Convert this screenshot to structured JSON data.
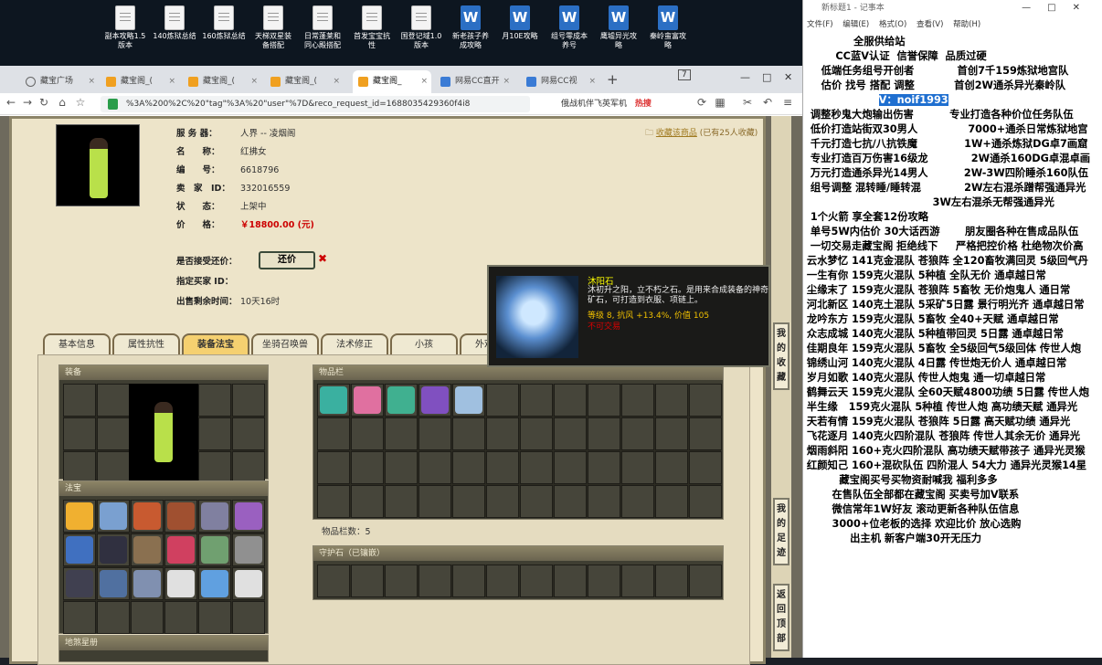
{
  "desktop": {
    "icons": [
      {
        "label": "副本攻略1.5\n版本",
        "kind": "txt"
      },
      {
        "label": "140炼狱总结",
        "kind": "txt"
      },
      {
        "label": "160炼狱总结",
        "kind": "txt"
      },
      {
        "label": "天梯双星装\n备搭配",
        "kind": "txt"
      },
      {
        "label": "日常蓬莱和\n同心殿搭配",
        "kind": "txt"
      },
      {
        "label": "首发宝宝抗\n性",
        "kind": "txt"
      },
      {
        "label": "国登记域1.0\n版本",
        "kind": "txt"
      },
      {
        "label": "新老孩子养\n成攻略",
        "kind": "doc"
      },
      {
        "label": "月10E攻略",
        "kind": "doc"
      },
      {
        "label": "组号零成本\n养号",
        "kind": "doc"
      },
      {
        "label": "鹰墟异光攻\n略",
        "kind": "doc"
      },
      {
        "label": "秦岭蛮富攻\n略",
        "kind": "doc"
      }
    ]
  },
  "browser": {
    "tabs": [
      {
        "title": "藏宝广场",
        "icon": "globe"
      },
      {
        "title": "藏宝阁_(",
        "icon": "cbg"
      },
      {
        "title": "藏宝阁_(",
        "icon": "cbg"
      },
      {
        "title": "藏宝阁_(",
        "icon": "cbg"
      },
      {
        "title": "藏宝阁_",
        "icon": "cbg",
        "active": true
      },
      {
        "title": "网易CC直开",
        "icon": "blue"
      },
      {
        "title": "网易CC视",
        "icon": "blue"
      }
    ],
    "new_tab": "+",
    "tab_count": "7",
    "url": "%3A%200%2C%20\"tag\"%3A%20\"user\"%7D&reco_request_id=1688035429360f4i8",
    "search_text": "俄战机伴飞英军机",
    "hot_label": "热搜"
  },
  "listing": {
    "server_label": "服 务 器：",
    "server_value": "人界 -- 凌烟阁",
    "name_label": "名　　称：",
    "name_value": "红拂女",
    "id_label": "编　　号：",
    "id_value": "6618796",
    "seller_label": "卖　家　ID：",
    "seller_value": "332016559",
    "status_label": "状　　态：",
    "status_value": "上架中",
    "price_label": "价　　格：",
    "price_value": "￥18800.00 (元)",
    "haggle_label": "是否接受还价：",
    "haggle_button": "还价",
    "buyer_label": "指定买家 ID：",
    "remaining_label": "出售剩余时间：",
    "remaining_value": "10天16时",
    "fav_link": "收藏该商品",
    "fav_count": "(已有25人收藏)"
  },
  "tabs": [
    "基本信息",
    "属性抗性",
    "装备法宝",
    "坐骑召唤兽",
    "法术修正",
    "小孩",
    "外观道具"
  ],
  "active_tab": 2,
  "sections": {
    "equip": "装备",
    "fabao": "法宝",
    "dihun": "地煞星册",
    "inventory": "物品栏",
    "inventory_count": "物品栏数：5",
    "guard": "守护石（已镶嵌）"
  },
  "tooltip": {
    "name": "沐阳石",
    "desc": "沐初升之阳，立不朽之石。是用来合成装备的神奇矿石，可打造到衣服、项链上。",
    "stats": "等级 8, 抗风 +13.4%, 价值 105",
    "state": "不可交易"
  },
  "side_buttons": [
    "我的收藏",
    "我的足迹",
    "返回顶部"
  ],
  "notepad": {
    "title": "新标题1 - 记事本",
    "menu": [
      "文件(F)",
      "编辑(E)",
      "格式(O)",
      "查看(V)",
      "帮助(H)"
    ],
    "lines": [
      "              全服供给站",
      "         CC蓝V认证  信誉保障  品质过硬",
      "     低端任务组号开创者            首创7千159炼狱地宫队",
      "     估价 找号 搭配 调整           首创2W通杀异光秦岭队",
      "                     V：noif1993",
      "",
      "  调整秒鬼大炮输出伤害          专业打造各种价位任务队伍",
      "  低价打造站街双30男人              7000+通杀日常炼狱地宫",
      "  千元打造七抗/八抗铁魔             1W+通杀炼狱DG卓7画窟",
      "  专业打造百万伤害16级龙            2W通杀160DG卓混卓画",
      "  万元打造通杀异光14男人          2W-3W四阶睡杀160队伍",
      "  组号调整 混转睡/睡转混            2W左右混杀蹭帮强通异光",
      "                                    3W左右混杀无帮强通异光",
      "  1个火箭 享全套12份攻略",
      "  单号5W内估价 30大话西游       朋友圈各种在售成品队伍",
      "  一切交易走藏宝阁 拒绝线下     严格把控价格 杜绝物次价高",
      "",
      "",
      " 云水梦忆 141克金混队 苍狼阵 全120畜牧满回灵 5级回气丹",
      " 一生有你 159克火混队 5种植 全队无价 通卓越日常",
      " 尘缘末了 159克火混队 苍狼阵 5畜牧 无价炮鬼人 通日常",
      " 河北新区 140克土混队 5采矿5日露 景行明光齐 通卓越日常",
      " 龙吟东方 159克火混队 5畜牧 全40+天赋 通卓越日常",
      " 众志成城 140克火混队 5种植带回灵 5日露 通卓越日常",
      " 佳期良年 159克火混队 5畜牧 全5级回气5级回体 传世人炮",
      " 锦绣山河 140克火混队 4日露 传世炮无价人 通卓越日常",
      " 岁月如歌 140克火混队 传世人炮鬼 通一切卓越日常",
      " 鹤舞云天 159克火混队 全60天赋4800功绩 5日露 传世人炮",
      " 半生缘   159克火混队 5种植 传世人炮 高功绩天赋 通异光",
      " 天若有情 159克火混队 苍狼阵 5日露 高天赋功绩 通异光",
      " 飞花逐月 140克火四阶混队 苍狼阵 传世人其余无价 通异光",
      " 烟雨斜阳 160+克火四阶混队 高功绩天赋带孩子 通异光灵猴",
      " 红颜知己 160+混砍队伍 四阶混人 54大力 通异光灵猴14星",
      "",
      "",
      "          藏宝阁买号买物资耐喊我 福利多多",
      "        在售队伍全部都在藏宝阁 买卖号加V联系",
      "        微信常年1W好友 滚动更新各种队伍信息",
      "        3000+位老板的选择 欢迎比价 放心选购",
      "             出主机 新客户端30开无压力"
    ]
  }
}
